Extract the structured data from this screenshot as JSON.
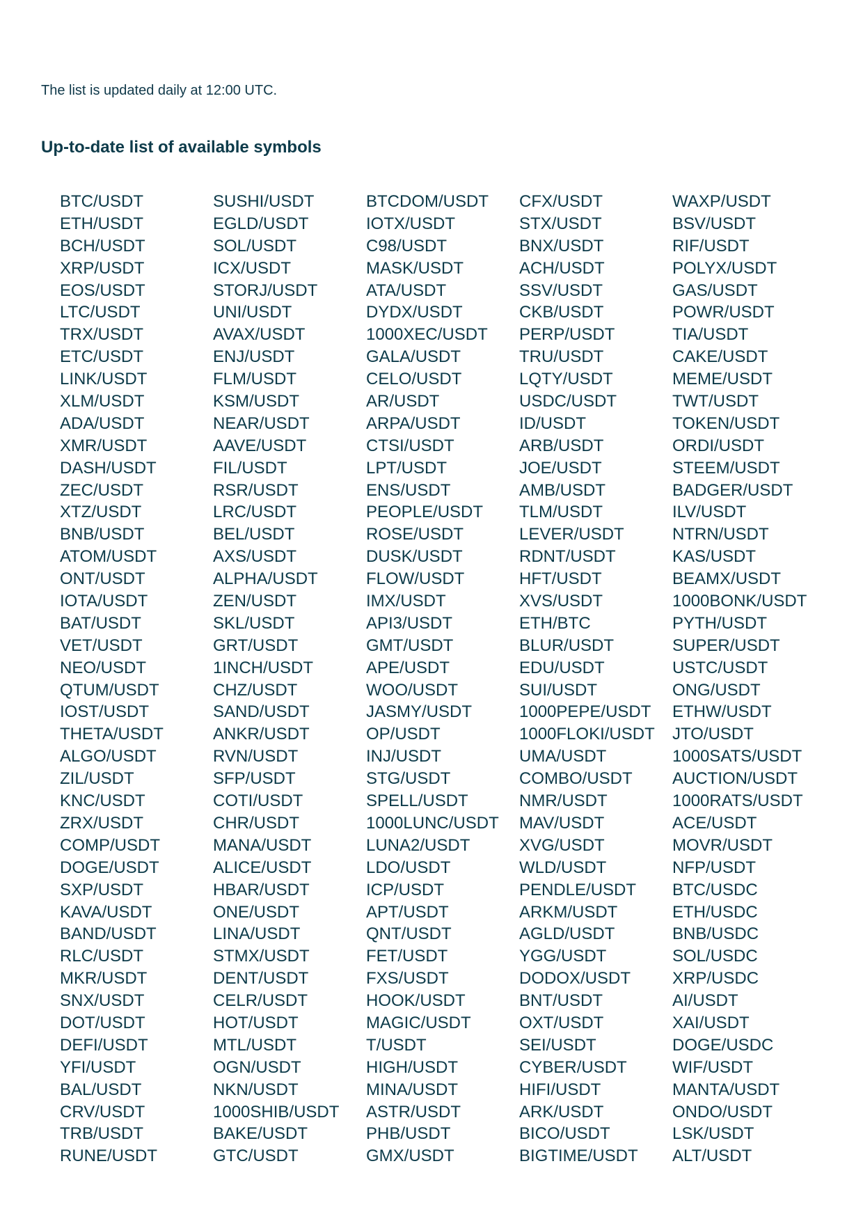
{
  "header": {
    "update_note": "The list is updated daily at 12:00 UTC.",
    "section_title": "Up-to-date list of available symbols"
  },
  "symbol_columns": [
    [
      "BTC/USDT",
      "ETH/USDT",
      "BCH/USDT",
      "XRP/USDT",
      "EOS/USDT",
      "LTC/USDT",
      "TRX/USDT",
      "ETC/USDT",
      "LINK/USDT",
      "XLM/USDT",
      "ADA/USDT",
      "XMR/USDT",
      "DASH/USDT",
      "ZEC/USDT",
      "XTZ/USDT",
      "BNB/USDT",
      "ATOM/USDT",
      "ONT/USDT",
      "IOTA/USDT",
      "BAT/USDT",
      "VET/USDT",
      "NEO/USDT",
      "QTUM/USDT",
      "IOST/USDT",
      "THETA/USDT",
      "ALGO/USDT",
      "ZIL/USDT",
      "KNC/USDT",
      "ZRX/USDT",
      "COMP/USDT",
      "DOGE/USDT",
      "SXP/USDT",
      "KAVA/USDT",
      "BAND/USDT",
      "RLC/USDT",
      "MKR/USDT",
      "SNX/USDT",
      "DOT/USDT",
      "DEFI/USDT",
      "YFI/USDT",
      "BAL/USDT",
      "CRV/USDT",
      "TRB/USDT",
      "RUNE/USDT"
    ],
    [
      "SUSHI/USDT",
      "EGLD/USDT",
      "SOL/USDT",
      "ICX/USDT",
      "STORJ/USDT",
      "UNI/USDT",
      "AVAX/USDT",
      "ENJ/USDT",
      "FLM/USDT",
      "KSM/USDT",
      "NEAR/USDT",
      "AAVE/USDT",
      "FIL/USDT",
      "RSR/USDT",
      "LRC/USDT",
      "BEL/USDT",
      "AXS/USDT",
      "ALPHA/USDT",
      "ZEN/USDT",
      "SKL/USDT",
      "GRT/USDT",
      "1INCH/USDT",
      "CHZ/USDT",
      "SAND/USDT",
      "ANKR/USDT",
      "RVN/USDT",
      "SFP/USDT",
      "COTI/USDT",
      "CHR/USDT",
      "MANA/USDT",
      "ALICE/USDT",
      "HBAR/USDT",
      "ONE/USDT",
      "LINA/USDT",
      "STMX/USDT",
      "DENT/USDT",
      "CELR/USDT",
      "HOT/USDT",
      "MTL/USDT",
      "OGN/USDT",
      "NKN/USDT",
      "1000SHIB/USDT",
      "BAKE/USDT",
      "GTC/USDT"
    ],
    [
      "BTCDOM/USDT",
      "IOTX/USDT",
      "C98/USDT",
      "MASK/USDT",
      "ATA/USDT",
      "DYDX/USDT",
      "1000XEC/USDT",
      "GALA/USDT",
      "CELO/USDT",
      "AR/USDT",
      "ARPA/USDT",
      "CTSI/USDT",
      "LPT/USDT",
      "ENS/USDT",
      "PEOPLE/USDT",
      "ROSE/USDT",
      "DUSK/USDT",
      "FLOW/USDT",
      "IMX/USDT",
      "API3/USDT",
      "GMT/USDT",
      "APE/USDT",
      "WOO/USDT",
      "JASMY/USDT",
      "OP/USDT",
      "INJ/USDT",
      "STG/USDT",
      "SPELL/USDT",
      "1000LUNC/USDT",
      "LUNA2/USDT",
      "LDO/USDT",
      "ICP/USDT",
      "APT/USDT",
      "QNT/USDT",
      "FET/USDT",
      "FXS/USDT",
      "HOOK/USDT",
      "MAGIC/USDT",
      "T/USDT",
      "HIGH/USDT",
      "MINA/USDT",
      "ASTR/USDT",
      "PHB/USDT",
      "GMX/USDT"
    ],
    [
      "CFX/USDT",
      "STX/USDT",
      "BNX/USDT",
      "ACH/USDT",
      "SSV/USDT",
      "CKB/USDT",
      "PERP/USDT",
      "TRU/USDT",
      "LQTY/USDT",
      "USDC/USDT",
      "ID/USDT",
      "ARB/USDT",
      "JOE/USDT",
      "AMB/USDT",
      "TLM/USDT",
      "LEVER/USDT",
      "RDNT/USDT",
      "HFT/USDT",
      "XVS/USDT",
      "ETH/BTC",
      "BLUR/USDT",
      "EDU/USDT",
      "SUI/USDT",
      "1000PEPE/USDT",
      "1000FLOKI/USDT",
      "UMA/USDT",
      "COMBO/USDT",
      "NMR/USDT",
      "MAV/USDT",
      "XVG/USDT",
      "WLD/USDT",
      "PENDLE/USDT",
      "ARKM/USDT",
      "AGLD/USDT",
      "YGG/USDT",
      "DODOX/USDT",
      "BNT/USDT",
      "OXT/USDT",
      "SEI/USDT",
      "CYBER/USDT",
      "HIFI/USDT",
      "ARK/USDT",
      "BICO/USDT",
      "BIGTIME/USDT"
    ],
    [
      "WAXP/USDT",
      "BSV/USDT",
      "RIF/USDT",
      "POLYX/USDT",
      "GAS/USDT",
      "POWR/USDT",
      "TIA/USDT",
      "CAKE/USDT",
      "MEME/USDT",
      "TWT/USDT",
      "TOKEN/USDT",
      "ORDI/USDT",
      "STEEM/USDT",
      "BADGER/USDT",
      "ILV/USDT",
      "NTRN/USDT",
      "KAS/USDT",
      "BEAMX/USDT",
      "1000BONK/USDT",
      "PYTH/USDT",
      "SUPER/USDT",
      "USTC/USDT",
      "ONG/USDT",
      "ETHW/USDT",
      "JTO/USDT",
      "1000SATS/USDT",
      "AUCTION/USDT",
      "1000RATS/USDT",
      "ACE/USDT",
      "MOVR/USDT",
      "NFP/USDT",
      "BTC/USDC",
      "ETH/USDC",
      "BNB/USDC",
      "SOL/USDC",
      "XRP/USDC",
      "AI/USDT",
      "XAI/USDT",
      "DOGE/USDC",
      "WIF/USDT",
      "MANTA/USDT",
      "ONDO/USDT",
      "LSK/USDT",
      "ALT/USDT"
    ]
  ]
}
